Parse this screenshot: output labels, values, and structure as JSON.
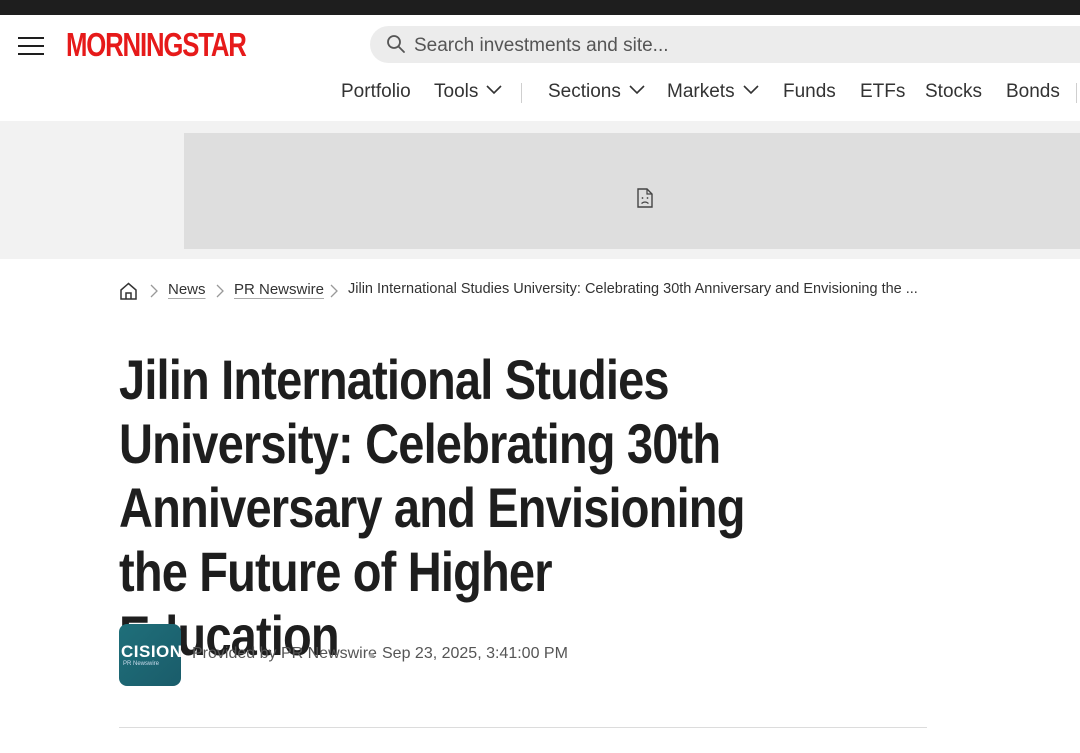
{
  "header": {
    "logo_text": "MORNINGSTAR",
    "search": {
      "placeholder": "Search investments and site..."
    },
    "nav": [
      {
        "label": "Portfolio",
        "dropdown": false
      },
      {
        "label": "Tools",
        "dropdown": true
      },
      {
        "label": "Sections",
        "dropdown": true
      },
      {
        "label": "Markets",
        "dropdown": true
      },
      {
        "label": "Funds",
        "dropdown": false
      },
      {
        "label": "ETFs",
        "dropdown": false
      },
      {
        "label": "Stocks",
        "dropdown": false
      },
      {
        "label": "Bonds",
        "dropdown": false
      }
    ]
  },
  "breadcrumb": {
    "items": [
      "News",
      "PR Newswire"
    ],
    "current": "Jilin International Studies University: Celebrating 30th Anniversary and Envisioning the ..."
  },
  "article": {
    "headline": "Jilin International Studies University: Celebrating 30th Anniversary and Envisioning the Future of Higher Education",
    "provider_logo_text": "CISION",
    "provider_logo_subtext": "PR Newswire",
    "provided_by": "Provided by PR Newswire",
    "date": "Sep 23, 2025, 3:41:00 PM"
  },
  "colors": {
    "brand_red": "#e61a1a",
    "text": "#1e1e1e",
    "topbar": "#1e1e1e",
    "provider_logo_bg": "#1f6f7a"
  },
  "icons": [
    "hamburger-menu-icon",
    "search-icon",
    "chevron-down-icon",
    "broken-image-icon",
    "home-icon",
    "chevron-right-icon"
  ]
}
